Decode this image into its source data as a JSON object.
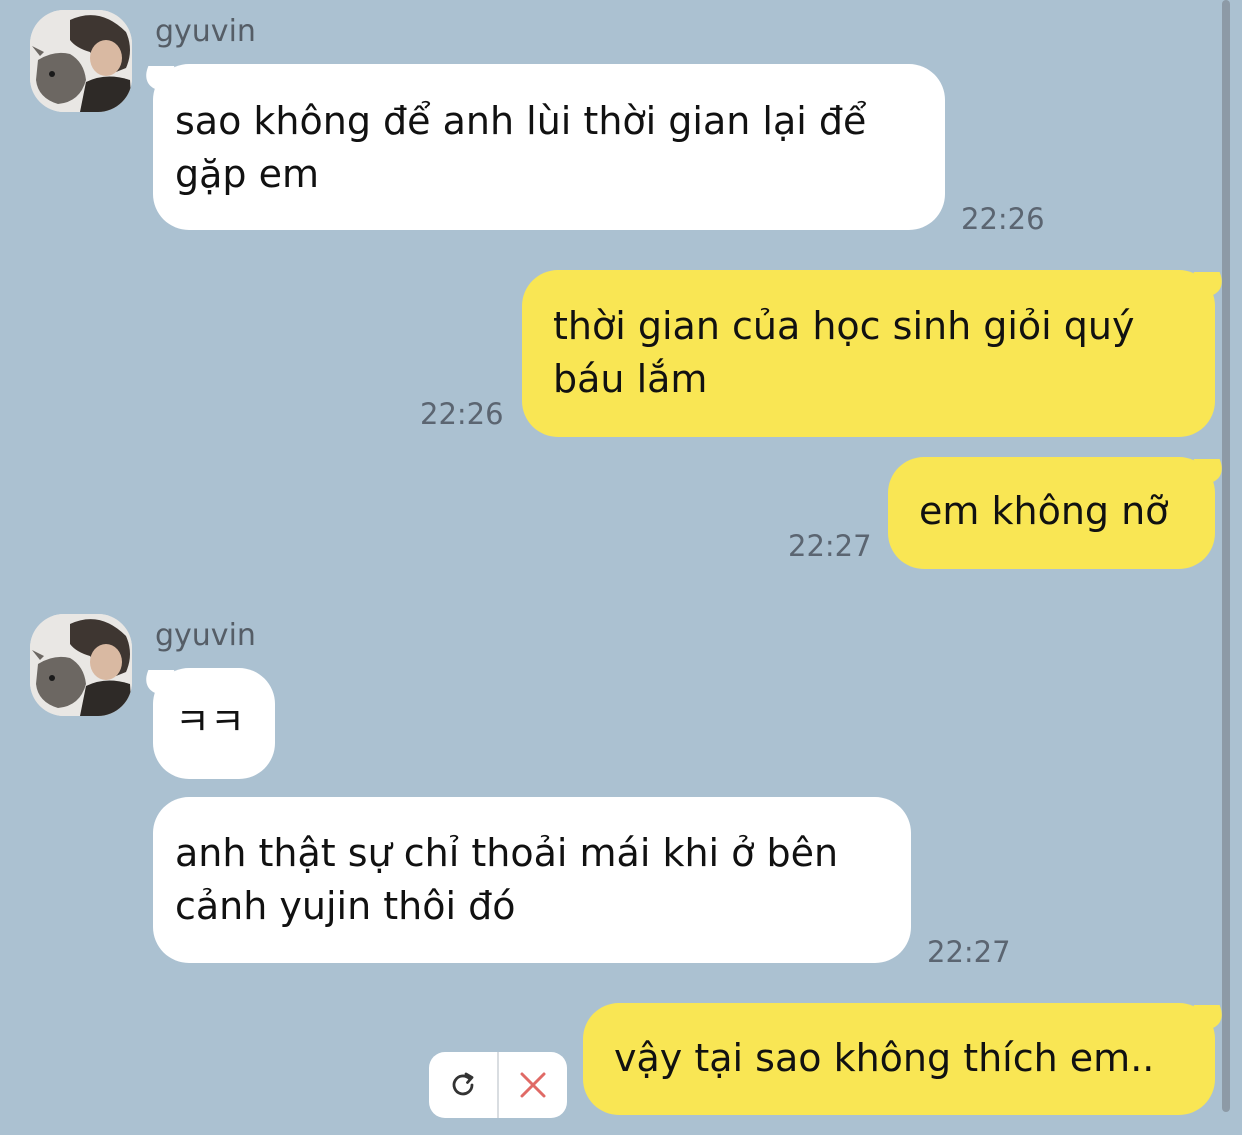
{
  "chat": {
    "messages": [
      {
        "sender": "gyuvin",
        "text": "sao không để anh lùi thời gian lại để gặp em",
        "time": "22:26",
        "direction": "incoming"
      },
      {
        "text": "thời gian của học sinh giỏi quý báu lắm",
        "time": "22:26",
        "direction": "outgoing"
      },
      {
        "text": "em không nỡ",
        "time": "22:27",
        "direction": "outgoing"
      },
      {
        "sender": "gyuvin",
        "text": "ㅋㅋ",
        "direction": "incoming"
      },
      {
        "text": "anh thật sự chỉ thoải mái khi ở bên cảnh yujin thôi đó",
        "time": "22:27",
        "direction": "incoming"
      },
      {
        "text": "vậy tại sao không thích em..",
        "direction": "outgoing",
        "status": "failed"
      }
    ],
    "failed_actions": {
      "retry_icon": "refresh-icon",
      "delete_icon": "close-icon"
    }
  },
  "colors": {
    "background": "#abc1d1",
    "incoming_bubble": "#ffffff",
    "outgoing_bubble": "#f9e654",
    "delete_icon": "#e06a66"
  }
}
